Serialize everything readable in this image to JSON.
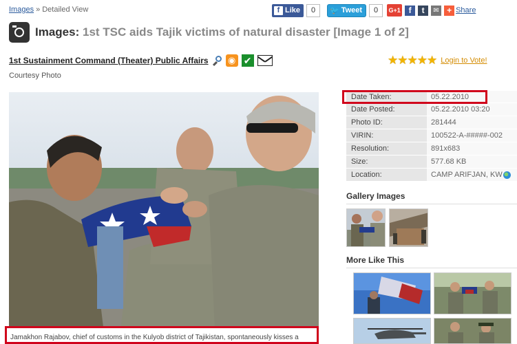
{
  "breadcrumb": {
    "images_link": "Images",
    "separator": "»",
    "current": "Detailed View"
  },
  "social": {
    "like_label": "Like",
    "like_count": "0",
    "tweet_label": "Tweet",
    "tweet_count": "0",
    "gplus_label": "G+1",
    "share_label": "Share"
  },
  "title": {
    "prefix": "Images:",
    "text": "1st TSC aids Tajik victims of natural disaster [Image 1 of 2]"
  },
  "unit": {
    "name": "1st Sustainment Command (Theater) Public Affairs"
  },
  "courtesy": "Courtesy Photo",
  "vote": {
    "stars": 5,
    "label": "Login to Vote!"
  },
  "details": [
    {
      "key": "Date Taken:",
      "value": "05.22.2010"
    },
    {
      "key": "Date Posted:",
      "value": "05.22.2010 03:20"
    },
    {
      "key": "Photo ID:",
      "value": "281444"
    },
    {
      "key": "VIRIN:",
      "value": "100522-A-#####-002"
    },
    {
      "key": "Resolution:",
      "value": "891x683"
    },
    {
      "key": "Size:",
      "value": "577.68 KB"
    },
    {
      "key": "Location:",
      "value": "CAMP ARIFJAN, KW"
    }
  ],
  "sections": {
    "gallery": "Gallery Images",
    "more": "More Like This"
  },
  "caption": "Jamakhon Rajabov, chief of customs in the Kulyob district of Tajikistan, spontaneously kisses a",
  "colors": {
    "highlight": "#d0021b",
    "link": "#2a5a9c",
    "vote_link": "#d48b00"
  }
}
